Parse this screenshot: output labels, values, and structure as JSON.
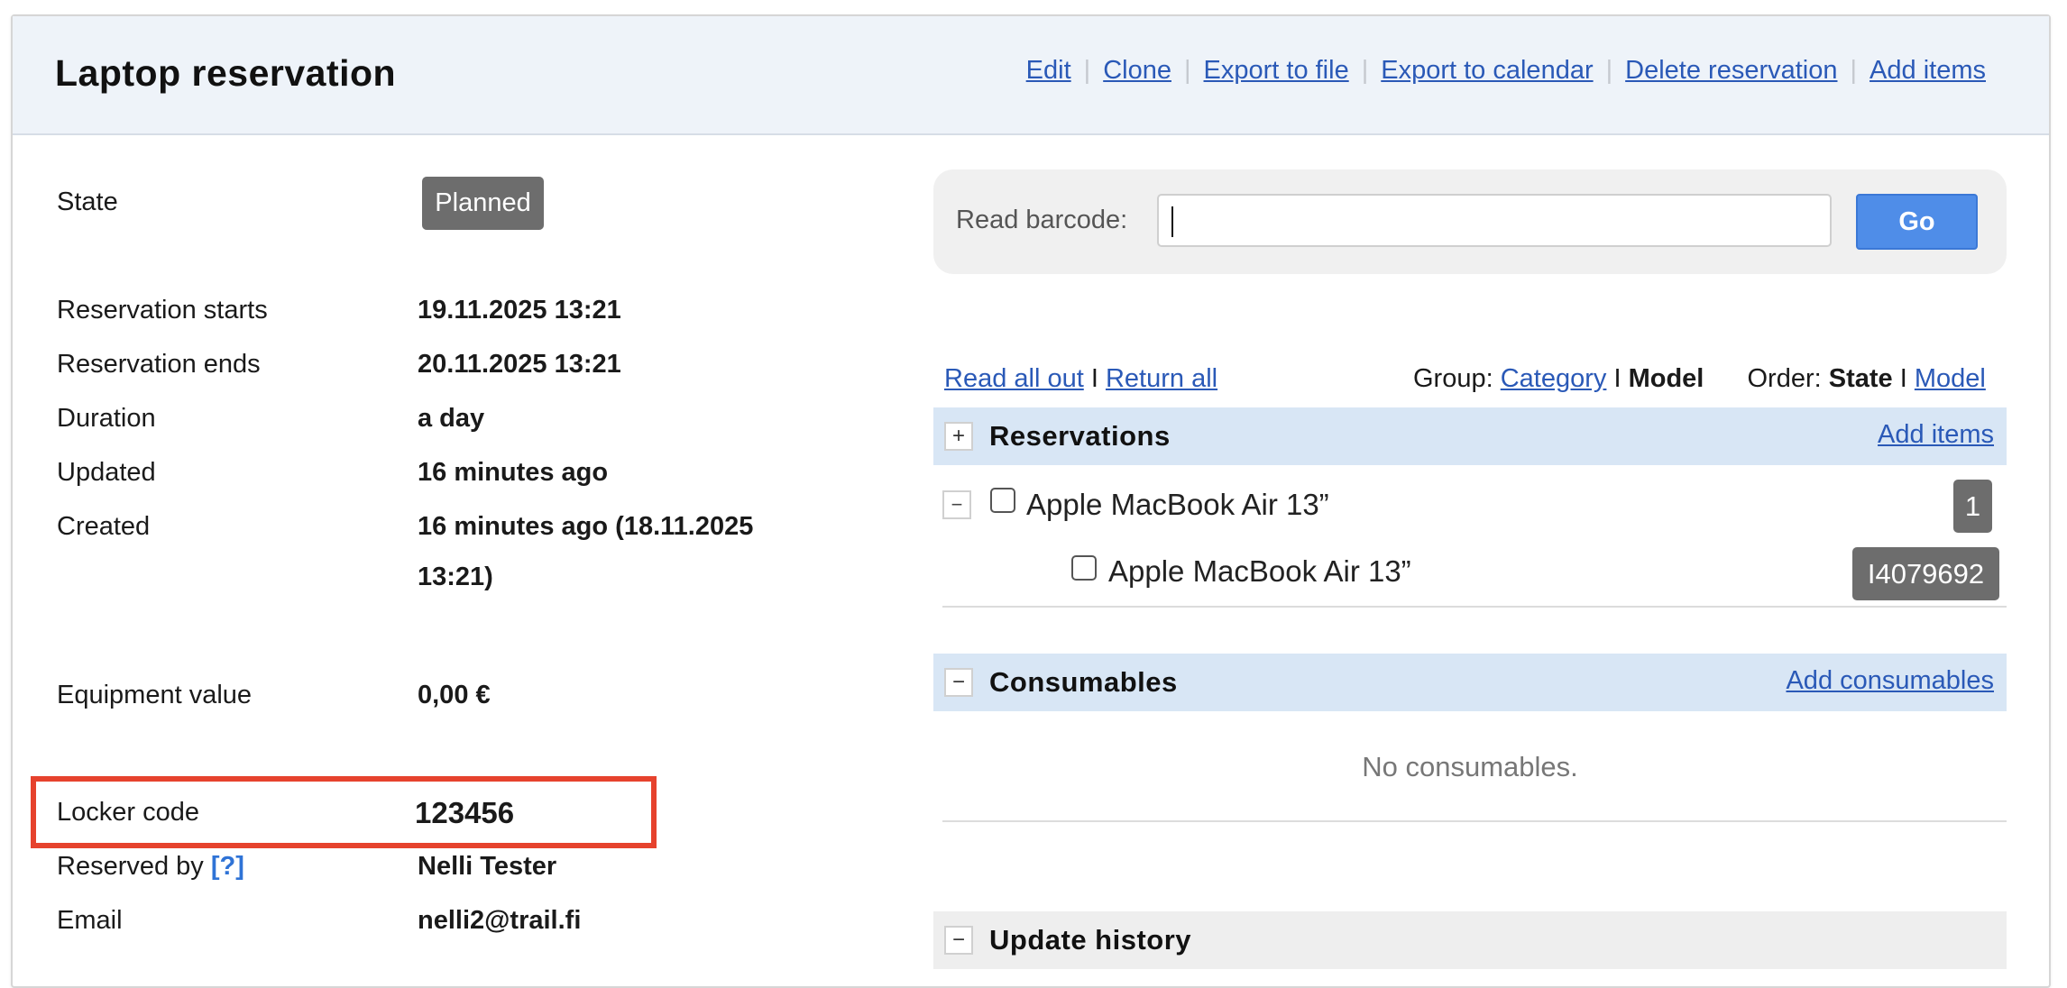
{
  "header": {
    "title": "Laptop reservation",
    "actions": [
      "Edit",
      "Clone",
      "Export to file",
      "Export to calendar",
      "Delete reservation",
      "Add items"
    ]
  },
  "details": {
    "state_label": "State",
    "state_value": "Planned",
    "starts_label": "Reservation starts",
    "starts_value": "19.11.2025 13:21",
    "ends_label": "Reservation ends",
    "ends_value": "20.11.2025 13:21",
    "duration_label": "Duration",
    "duration_value": "a day",
    "updated_label": "Updated",
    "updated_value": "16 minutes ago",
    "created_label": "Created",
    "created_value_line1": "16 minutes ago (18.11.2025",
    "created_value_line2": "13:21)",
    "equipment_label": "Equipment value",
    "equipment_value": "0,00 €",
    "locker_label": "Locker code",
    "locker_value": "123456",
    "reserved_by_label": "Reserved by",
    "reserved_by_help": "[?]",
    "reserved_by_value": "Nelli Tester",
    "email_label": "Email",
    "email_value": "nelli2@trail.fi",
    "highlight_color": "#e6422d"
  },
  "barcode": {
    "label": "Read barcode:",
    "value": "",
    "go_label": "Go"
  },
  "toolbar": {
    "read_all_out": "Read all out",
    "divider": "I",
    "return_all": "Return all",
    "group_label": "Group:",
    "group_category": "Category",
    "group_model": "Model",
    "order_label": "Order:",
    "order_state": "State",
    "order_model": "Model"
  },
  "reservations": {
    "toggle": "+",
    "title": "Reservations",
    "add_link": "Add items",
    "group_toggle": "−",
    "group_name": "Apple MacBook Air 13”",
    "group_count": "1",
    "item_name": "Apple MacBook Air 13”",
    "item_code": "I4079692"
  },
  "consumables": {
    "toggle": "−",
    "title": "Consumables",
    "add_link": "Add consumables",
    "empty_text": "No consumables."
  },
  "history": {
    "toggle": "−",
    "title": "Update history"
  },
  "colors": {
    "header_bg": "#eef3f9",
    "link": "#2a59b7",
    "section_bg": "#d8e6f5",
    "badge_bg": "#6d6d6d",
    "go_button": "#4f8de8"
  }
}
